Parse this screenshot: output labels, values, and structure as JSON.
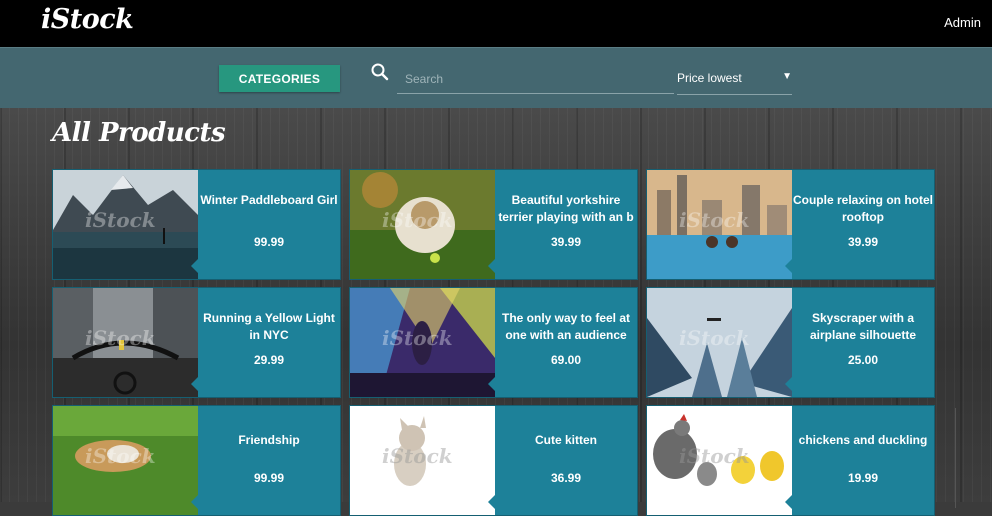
{
  "app": {
    "logo": "iStock",
    "user": "Admin"
  },
  "filters": {
    "categories_label": "CATEGORIES",
    "search_placeholder": "Search",
    "sort_value": "Price lowest",
    "sort_arrow": "▼"
  },
  "page": {
    "title": "All Products"
  },
  "products": [
    {
      "title": "Winter Paddleboard Girl",
      "price": "99.99"
    },
    {
      "title": "Beautiful yorkshire terrier playing with an b",
      "price": "39.99"
    },
    {
      "title": "Couple relaxing on hotel rooftop",
      "price": "39.99"
    },
    {
      "title": "Running a Yellow Light in NYC",
      "price": "29.99"
    },
    {
      "title": "The only way to feel at one with an audience",
      "price": "69.00"
    },
    {
      "title": "Skyscraper with a airplane silhouette",
      "price": "25.00"
    },
    {
      "title": "Friendship",
      "price": "99.99"
    },
    {
      "title": "Cute kitten",
      "price": "36.99"
    },
    {
      "title": "chickens and duckling",
      "price": "19.99"
    }
  ]
}
